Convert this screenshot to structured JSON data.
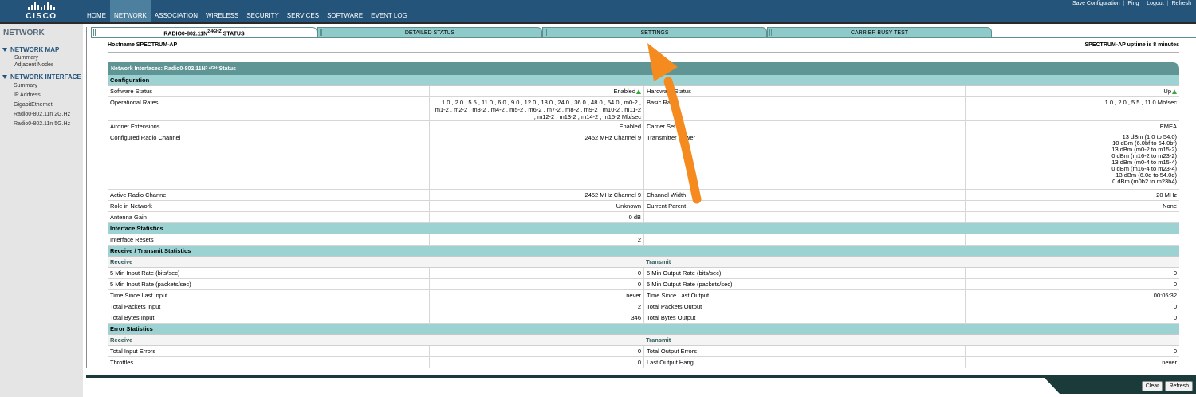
{
  "brand": {
    "name": "CISCO"
  },
  "topnav": [
    {
      "label": "HOME",
      "active": false
    },
    {
      "label": "NETWORK",
      "active": true
    },
    {
      "label": "ASSOCIATION",
      "active": false
    },
    {
      "label": "WIRELESS",
      "active": false
    },
    {
      "label": "SECURITY",
      "active": false
    },
    {
      "label": "SERVICES",
      "active": false
    },
    {
      "label": "SOFTWARE",
      "active": false
    },
    {
      "label": "EVENT LOG",
      "active": false
    }
  ],
  "toplinks": {
    "save": "Save Configuration",
    "ping": "Ping",
    "logout": "Logout",
    "refresh": "Refresh"
  },
  "sidebar": {
    "title": "NETWORK",
    "network_map": {
      "label": "NETWORK MAP",
      "items": [
        "Summary",
        "Adjacent Nodes"
      ]
    },
    "network_interface": {
      "label": "NETWORK INTERFACE",
      "items": [
        "Summary",
        "IP Address",
        "GigabitEthernet",
        "Radio0-802.11n 2G.Hz",
        "Radio0-802.11n 5G.Hz"
      ]
    }
  },
  "tabs": {
    "status_prefix": "RADIO0-802.11N",
    "status_sup": "2.4GHZ",
    "status_suffix": "STATUS",
    "detailed": "DETAILED STATUS",
    "settings": "SETTINGS",
    "carrier": "CARRIER BUSY TEST"
  },
  "host": {
    "label": "Hostname  SPECTRUM-AP",
    "uptime": "SPECTRUM-AP uptime is 8 minutes"
  },
  "panel": {
    "title_prefix": "Network Interfaces: Radio0-802.11N",
    "title_sup": "2.4GHz",
    "title_suffix": " Status",
    "config": {
      "heading": "Configuration",
      "software_status_label": "Software Status",
      "software_status_value": "Enabled",
      "hardware_status_label": "Hardware Status",
      "hardware_status_value": "Up",
      "operational_rates_label": "Operational Rates",
      "operational_rates_value": "1.0 , 2.0 , 5.5 , 11.0 , 6.0 , 9.0 , 12.0 , 18.0 , 24.0 , 36.0 , 48.0 , 54.0 , m0-2 , m1-2 , m2-2 , m3-2 , m4-2 , m5-2 , m6-2 , m7-2 , m8-2 , m9-2 , m10-2 , m11-2 , m12-2 , m13-2 , m14-2 , m15-2 Mb/sec",
      "basic_rates_label": "Basic Rates",
      "basic_rates_value": "1.0 , 2.0 , 5.5 , 11.0 Mb/sec",
      "aironet_label": "Aironet Extensions",
      "aironet_value": "Enabled",
      "carrier_set_label": "Carrier Set",
      "carrier_set_value": "EMEA",
      "configured_channel_label": "Configured Radio Channel",
      "configured_channel_value": "2452 MHz Channel 9",
      "tx_power_label": "Transmitter Power",
      "tx_power_values": [
        "13 dBm (1.0 to 54.0)",
        "10 dBm (6.0bf to 54.0bf)",
        "13 dBm (m0-2 to m15-2)",
        "0 dBm (m16-2 to m23-2)",
        "13 dBm (m0-4 to m15-4)",
        "0 dBm (m16-4 to m23-4)",
        "13 dBm (6.0d to 54.0d)",
        "0 dBm (m0b2 to m23b4)"
      ],
      "active_channel_label": "Active Radio Channel",
      "active_channel_value": "2452 MHz Channel 9",
      "channel_width_label": "Channel Width",
      "channel_width_value": "20 MHz",
      "role_label": "Role in Network",
      "role_value": "Unknown",
      "parent_label": "Current Parent",
      "parent_value": "None",
      "antenna_label": "Antenna Gain",
      "antenna_value": "0 dB"
    },
    "iface_stats": {
      "heading": "Interface Statistics",
      "resets_label": "Interface Resets",
      "resets_value": "2"
    },
    "rxtx": {
      "heading": "Receive / Transmit Statistics",
      "receive": "Receive",
      "transmit": "Transmit",
      "rows": [
        {
          "rl": "5 Min Input Rate (bits/sec)",
          "rv": "0",
          "tl": "5 Min Output Rate (bits/sec)",
          "tv": "0"
        },
        {
          "rl": "5 Min Input Rate (packets/sec)",
          "rv": "0",
          "tl": "5 Min Output Rate (packets/sec)",
          "tv": "0"
        },
        {
          "rl": "Time Since Last Input",
          "rv": "never",
          "tl": "Time Since Last Output",
          "tv": "00:05:32"
        },
        {
          "rl": "Total Packets Input",
          "rv": "2",
          "tl": "Total Packets Output",
          "tv": "0"
        },
        {
          "rl": "Total Bytes Input",
          "rv": "346",
          "tl": "Total Bytes Output",
          "tv": "0"
        }
      ]
    },
    "errors": {
      "heading": "Error Statistics",
      "receive": "Receive",
      "transmit": "Transmit",
      "rows": [
        {
          "rl": "Total Input Errors",
          "rv": "0",
          "tl": "Total Output Errors",
          "tv": "0"
        },
        {
          "rl": "Throttles",
          "rv": "0",
          "tl": "Last Output Hang",
          "tv": "never"
        }
      ]
    }
  },
  "buttons": {
    "clear": "Clear",
    "refresh": "Refresh"
  },
  "colors": {
    "header": "#24547a",
    "section": "#9cd2d2",
    "panel_title": "#5f9595",
    "annotation_arrow": "#f58a1f"
  }
}
